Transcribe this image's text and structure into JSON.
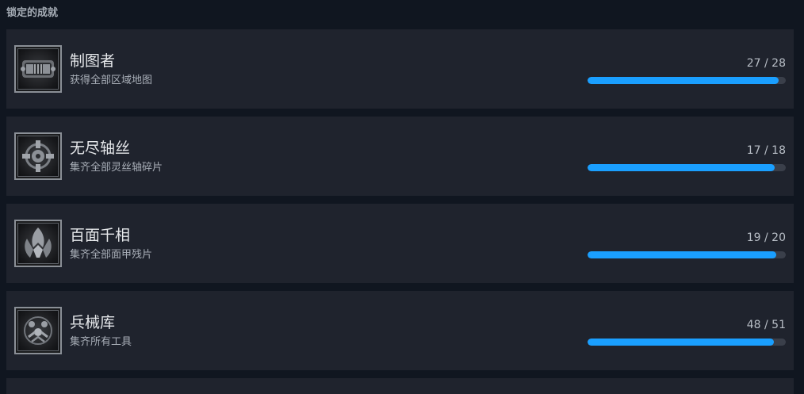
{
  "section": {
    "title": "锁定的成就"
  },
  "achievements": [
    {
      "name": "制图者",
      "description": "获得全部区域地图",
      "progress_text": "27 / 28",
      "progress": 0.964,
      "icon": "map-scroll-icon"
    },
    {
      "name": "无尽轴丝",
      "description": "集齐全部灵丝轴碎片",
      "progress_text": "17 / 18",
      "progress": 0.944,
      "icon": "silk-spool-icon"
    },
    {
      "name": "百面千相",
      "description": "集齐全部面甲残片",
      "progress_text": "19 / 20",
      "progress": 0.95,
      "icon": "mask-shards-icon"
    },
    {
      "name": "兵械库",
      "description": "集齐所有工具",
      "progress_text": "48 / 51",
      "progress": 0.941,
      "icon": "tool-arsenal-icon"
    }
  ],
  "colors": {
    "progress_fill": "#1a9fff",
    "progress_track": "#3a3f4a",
    "card_background": "#1f232d",
    "page_background": "#101620"
  }
}
